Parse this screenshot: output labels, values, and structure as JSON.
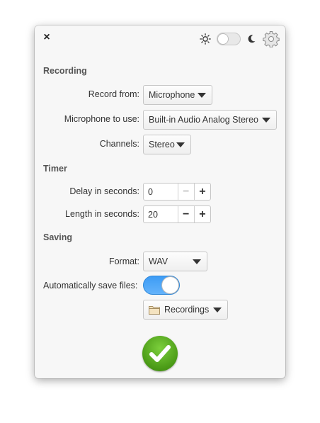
{
  "header": {
    "close_icon": "close-icon",
    "light_icon": "sun-icon",
    "dark_icon": "moon-icon",
    "settings_icon": "gear-icon",
    "dark_mode_on": false
  },
  "recording": {
    "title": "Recording",
    "record_from_label": "Record from:",
    "record_from_value": "Microphone",
    "microphone_label": "Microphone to use:",
    "microphone_value": "Built-in Audio Analog Stereo",
    "channels_label": "Channels:",
    "channels_value": "Stereo"
  },
  "timer": {
    "title": "Timer",
    "delay_label": "Delay in seconds:",
    "delay_value": "0",
    "length_label": "Length in seconds:",
    "length_value": "20",
    "minus": "−",
    "plus": "+"
  },
  "saving": {
    "title": "Saving",
    "format_label": "Format:",
    "format_value": "WAV",
    "autosave_label": "Automatically save files:",
    "autosave_on": true,
    "folder_value": "Recordings"
  },
  "colors": {
    "accent": "#3d9cf5",
    "confirm": "#4a9a16"
  }
}
